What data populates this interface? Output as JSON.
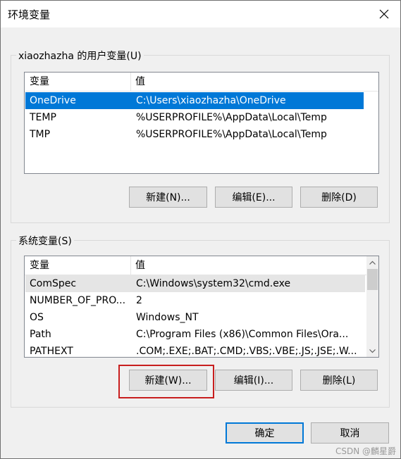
{
  "window": {
    "title": "环境变量"
  },
  "user_vars": {
    "label": "xiaozhazha 的用户变量(U)",
    "col_name": "变量",
    "col_value": "值",
    "rows": [
      {
        "name": "OneDrive",
        "value": "C:\\Users\\xiaozhazha\\OneDrive",
        "selected": true
      },
      {
        "name": "TEMP",
        "value": "%USERPROFILE%\\AppData\\Local\\Temp"
      },
      {
        "name": "TMP",
        "value": "%USERPROFILE%\\AppData\\Local\\Temp"
      }
    ],
    "buttons": {
      "new": "新建(N)...",
      "edit": "编辑(E)...",
      "delete": "删除(D)"
    }
  },
  "system_vars": {
    "label": "系统变量(S)",
    "col_name": "变量",
    "col_value": "值",
    "rows": [
      {
        "name": "ComSpec",
        "value": "C:\\Windows\\system32\\cmd.exe",
        "highlighted": true
      },
      {
        "name": "NUMBER_OF_PRO...",
        "value": "2"
      },
      {
        "name": "OS",
        "value": "Windows_NT"
      },
      {
        "name": "Path",
        "value": "C:\\Program Files (x86)\\Common Files\\Ora..."
      },
      {
        "name": "PATHEXT",
        "value": ".COM;.EXE;.BAT;.CMD;.VBS;.VBE;.JS;.JSE;.W..."
      }
    ],
    "buttons": {
      "new": "新建(W)...",
      "edit": "编辑(I)...",
      "delete": "删除(L)"
    }
  },
  "footer": {
    "ok": "确定",
    "cancel": "取消"
  },
  "watermark": "CSDN @麟星爵",
  "colors": {
    "selection": "#0078d7",
    "annotation": "#c81e1e"
  }
}
